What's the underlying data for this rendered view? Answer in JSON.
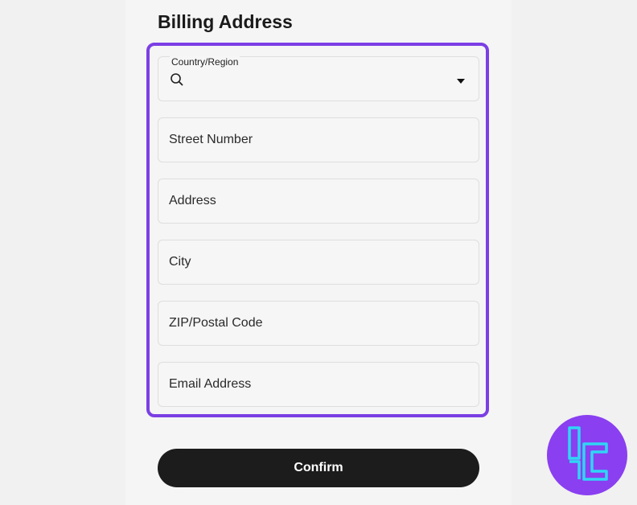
{
  "page": {
    "title": "Billing Address"
  },
  "form": {
    "country": {
      "label": "Country/Region",
      "value": "",
      "icon": "search-icon",
      "dropdown_icon": "caret-down-icon"
    },
    "fields": [
      {
        "placeholder": "Street Number"
      },
      {
        "placeholder": "Address"
      },
      {
        "placeholder": "City"
      },
      {
        "placeholder": "ZIP/Postal Code"
      },
      {
        "placeholder": "Email Address"
      }
    ],
    "confirm_label": "Confirm"
  },
  "colors": {
    "highlight": "#7b3fe4",
    "button": "#1c1c1c",
    "logo_bg": "#8a3ff0",
    "logo_mark": "#2fd6f5"
  }
}
